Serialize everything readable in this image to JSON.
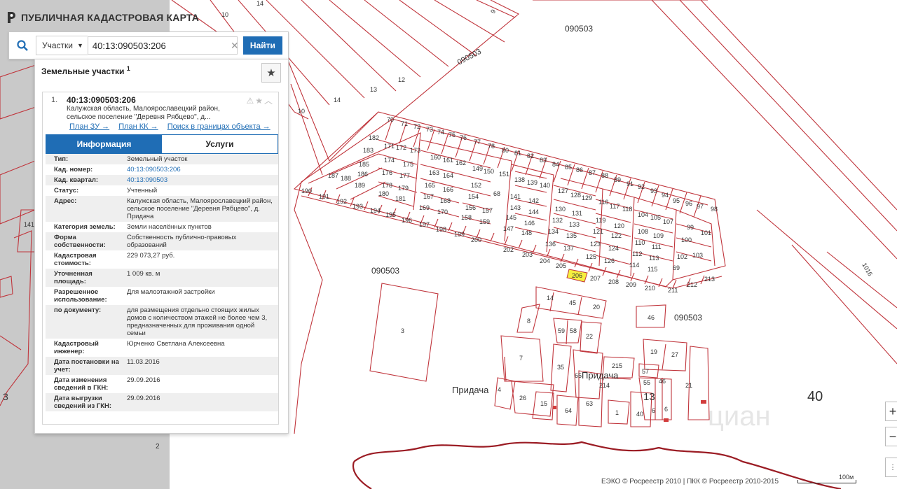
{
  "app": {
    "title": "ПУБЛИЧНАЯ КАДАСТРОВАЯ КАРТА"
  },
  "search": {
    "category": "Участки",
    "value": "40:13:090503:206",
    "button": "Найти"
  },
  "panel": {
    "title": "Земельные участки",
    "count": "1",
    "result": {
      "index": "1.",
      "cad_number": "40:13:090503:206",
      "address_short": "Калужская область, Малоярославецкий район, сельское поселение \"Деревня Рябцево\", д...",
      "links": [
        "План ЗУ →",
        "План КК →",
        "Поиск в границах объекта →"
      ],
      "tabs": [
        "Информация",
        "Услуги"
      ],
      "fields": [
        {
          "key": "Тип:",
          "value": "Земельный участок"
        },
        {
          "key": "Кад. номер:",
          "value": "40:13:090503:206",
          "link": true
        },
        {
          "key": "Кад. квартал:",
          "value": "40:13:090503",
          "link": true
        },
        {
          "key": "Статус:",
          "value": "Учтенный"
        },
        {
          "key": "Адрес:",
          "value": "Калужская область, Малоярославецкий район, сельское поселение \"Деревня Рябцево\", д. Придача"
        },
        {
          "key": "Категория земель:",
          "value": "Земли населённых пунктов"
        },
        {
          "key": "Форма собственности:",
          "value": "Собственность публично-правовых образований"
        },
        {
          "key": "Кадастровая стоимость:",
          "value": "229 073,27 руб."
        },
        {
          "key": "Уточненная площадь:",
          "value": "1 009 кв. м"
        },
        {
          "key": "Разрешенное использование:",
          "value": "Для малоэтажной застройки"
        },
        {
          "key": "по документу:",
          "value": "для размещения отдельно стоящих жилых домов с количеством этажей не более чем 3, предназначенных для проживания одной семьи"
        },
        {
          "key": "Кадастровый инженер:",
          "value": "Юрченко Светлана Алексеевна"
        },
        {
          "key": "Дата постановки на учет:",
          "value": "11.03.2016"
        },
        {
          "key": "Дата изменения сведений в ГКН:",
          "value": "29.09.2016"
        },
        {
          "key": "Дата выгрузки сведений из ГКН:",
          "value": "29.09.2016"
        }
      ]
    }
  },
  "map": {
    "labels": {
      "quarter_top": "090503",
      "quarter_road": "090503",
      "quarter_mid": "090503",
      "quarter_right": "090503",
      "village_left": "Придача",
      "village_right": "Придача",
      "district": "40",
      "num_13": "13",
      "num_3": "3",
      "num_2": "2",
      "num_141": "141",
      "road_1016": "1016",
      "top_10": "10",
      "top_14": "14",
      "top_13": "13",
      "top_12": "12",
      "top_10b": "10",
      "top_14b": "14",
      "top_9": "9"
    },
    "highlighted_plot": "206",
    "watermark": "циан",
    "colors": {
      "parcel": "#c0353c",
      "highlight": "#f6ef3f",
      "shadow": "#c8c8c8"
    }
  },
  "footer": {
    "attribution": "ЕЭКО © Росреестр 2010 | ПКК © Росреестр 2010-2015",
    "scale": "100м"
  },
  "controls": {
    "zoom_in": "+",
    "zoom_out": "−"
  }
}
